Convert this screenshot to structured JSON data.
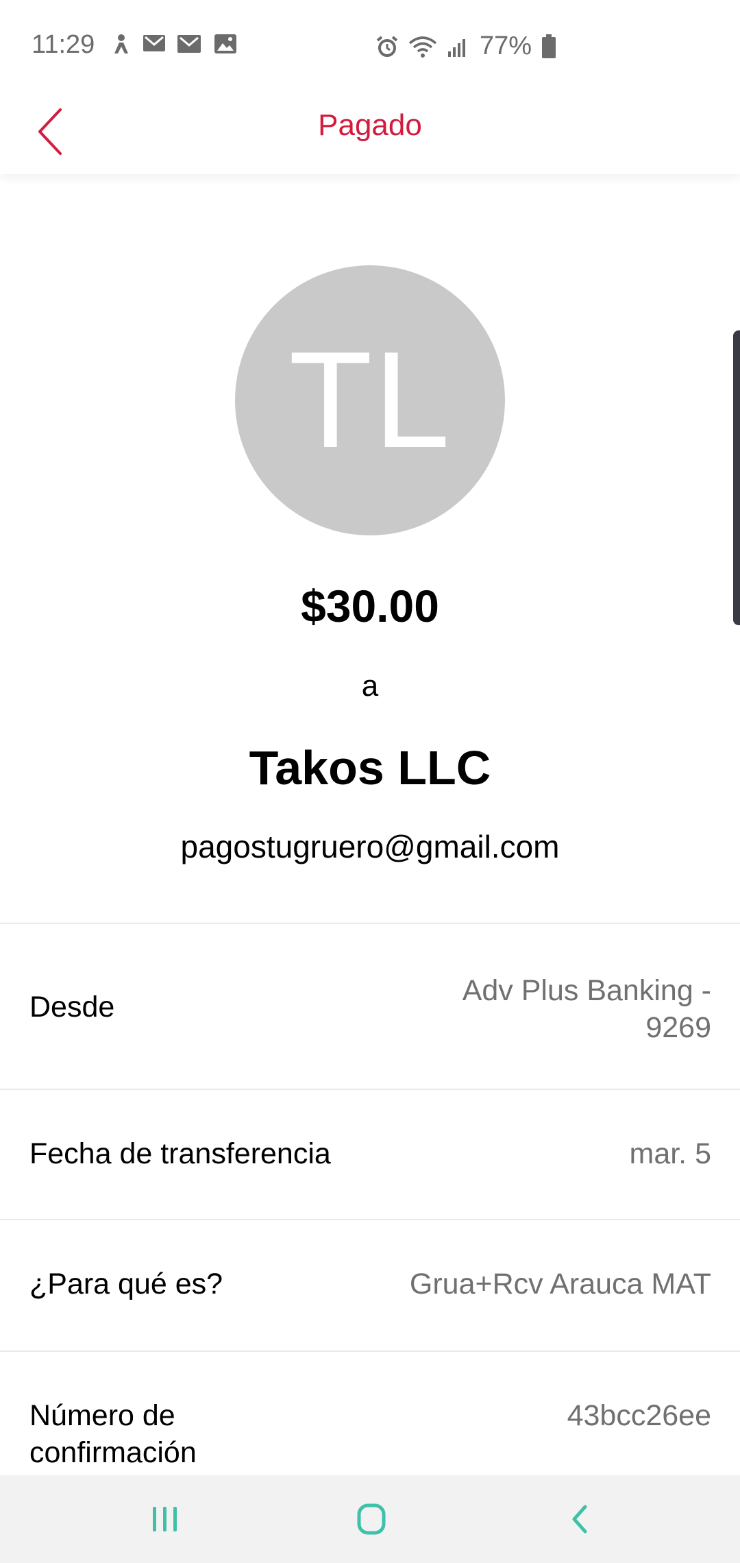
{
  "status_bar": {
    "time": "11:29",
    "battery_percent": "77%",
    "left_icons": [
      "accessibility-icon",
      "gmail-icon",
      "gmail-icon",
      "gallery-icon"
    ],
    "right_icons": [
      "alarm-icon",
      "wifi-icon",
      "signal-icon",
      "battery-icon"
    ]
  },
  "header": {
    "title": "Pagado"
  },
  "payment": {
    "avatar_initials": "TL",
    "amount": "$30.00",
    "to_label": "a",
    "recipient_name": "Takos LLC",
    "recipient_email": "pagostugruero@gmail.com"
  },
  "details": {
    "from_label": "Desde",
    "from_value_line1": "Adv Plus Banking -",
    "from_value_line2": "9269",
    "date_label": "Fecha de transferencia",
    "date_value": "mar. 5",
    "memo_label": "¿Para qué es?",
    "memo_value": "Grua+Rcv Arauca MAT",
    "confirmation_label_line1": "Número de",
    "confirmation_label_line2": "confirmación",
    "confirmation_value": "43bcc26ee"
  },
  "colors": {
    "accent": "#d31b3d",
    "avatar_bg": "#c9c9c9",
    "nav_icons": "#3fc1a9"
  }
}
